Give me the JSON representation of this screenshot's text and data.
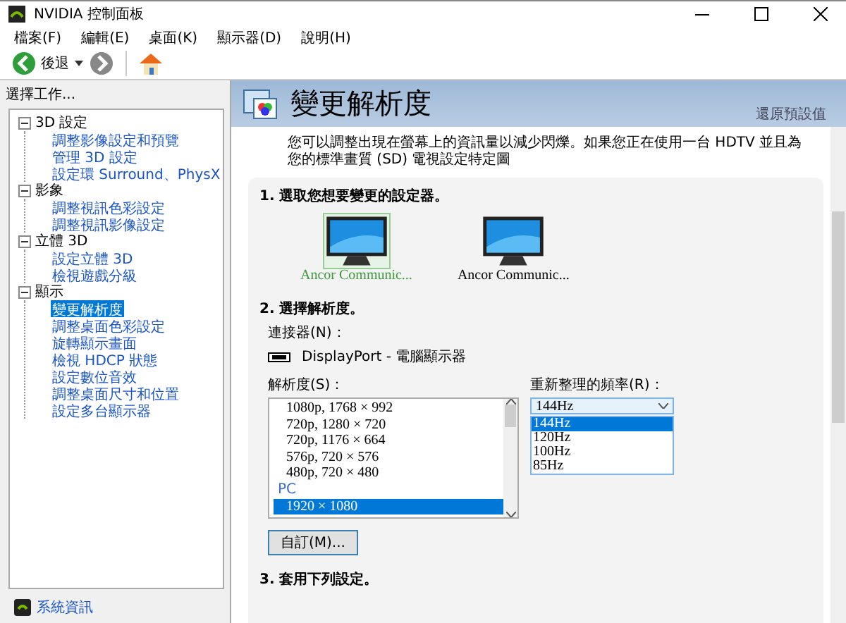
{
  "window": {
    "title": "NVIDIA 控制面板"
  },
  "menu": [
    "檔案(F)",
    "編輯(E)",
    "桌面(K)",
    "顯示器(D)",
    "說明(H)"
  ],
  "toolbar": {
    "back": "後退"
  },
  "sidebar": {
    "heading": "選擇工作...",
    "tree": [
      {
        "label": "3D 設定",
        "expanded": true,
        "children": [
          {
            "label": "調整影像設定和預覽",
            "selected": false
          },
          {
            "label": "管理 3D 設定",
            "selected": false
          },
          {
            "label": "設定環 Surround、PhysX",
            "selected": false
          }
        ]
      },
      {
        "label": "影象",
        "expanded": true,
        "children": [
          {
            "label": "調整視訊色彩設定",
            "selected": false
          },
          {
            "label": "調整視訊影像設定",
            "selected": false
          }
        ]
      },
      {
        "label": "立體 3D",
        "expanded": true,
        "children": [
          {
            "label": "設定立體 3D",
            "selected": false
          },
          {
            "label": "檢視遊戲分級",
            "selected": false
          }
        ]
      },
      {
        "label": "顯示",
        "expanded": true,
        "children": [
          {
            "label": "變更解析度",
            "selected": true
          },
          {
            "label": "調整桌面色彩設定",
            "selected": false
          },
          {
            "label": "旋轉顯示畫面",
            "selected": false
          },
          {
            "label": "檢視 HDCP 狀態",
            "selected": false
          },
          {
            "label": "設定數位音效",
            "selected": false
          },
          {
            "label": "調整桌面尺寸和位置",
            "selected": false
          },
          {
            "label": "設定多台顯示器",
            "selected": false
          }
        ]
      }
    ],
    "footer_link": "系統資訊"
  },
  "page": {
    "title": "變更解析度",
    "restore_link": "還原預設值",
    "description": "您可以調整出現在螢幕上的資訊量以減少閃爍。如果您正在使用一台 HDTV 並且為您的標準畫質 (SD) 電視設定特定圖",
    "section_1": {
      "heading": "1. 選取您想要變更的設定器。",
      "displays": [
        {
          "label": "Ancor Communic...",
          "selected": true
        },
        {
          "label": "Ancor Communic...",
          "selected": false
        }
      ]
    },
    "section_2": {
      "heading": "2. 選擇解析度。",
      "connector_label": "連接器(N)：",
      "connector": "DisplayPort - 電腦顯示器",
      "resolution_label": "解析度(S)：",
      "resolutions": [
        {
          "kind": "item",
          "label": "1080p, 1768 × 992",
          "selected": false
        },
        {
          "kind": "item",
          "label": "720p, 1280 × 720",
          "selected": false
        },
        {
          "kind": "item",
          "label": "720p, 1176 × 664",
          "selected": false
        },
        {
          "kind": "item",
          "label": "576p, 720 × 576",
          "selected": false
        },
        {
          "kind": "item",
          "label": "480p, 720 × 480",
          "selected": false
        },
        {
          "kind": "group",
          "label": "PC"
        },
        {
          "kind": "item",
          "label": "1920 × 1080",
          "selected": true
        }
      ],
      "refresh_label": "重新整理的頻率(R)：",
      "refresh_value": "144Hz",
      "refresh_options": [
        {
          "label": "144Hz",
          "selected": true
        },
        {
          "label": "120Hz",
          "selected": false
        },
        {
          "label": "100Hz",
          "selected": false
        },
        {
          "label": "85Hz",
          "selected": false
        }
      ],
      "custom_button": "自訂(M)..."
    },
    "section_3": {
      "heading": "3. 套用下列設定。"
    }
  }
}
